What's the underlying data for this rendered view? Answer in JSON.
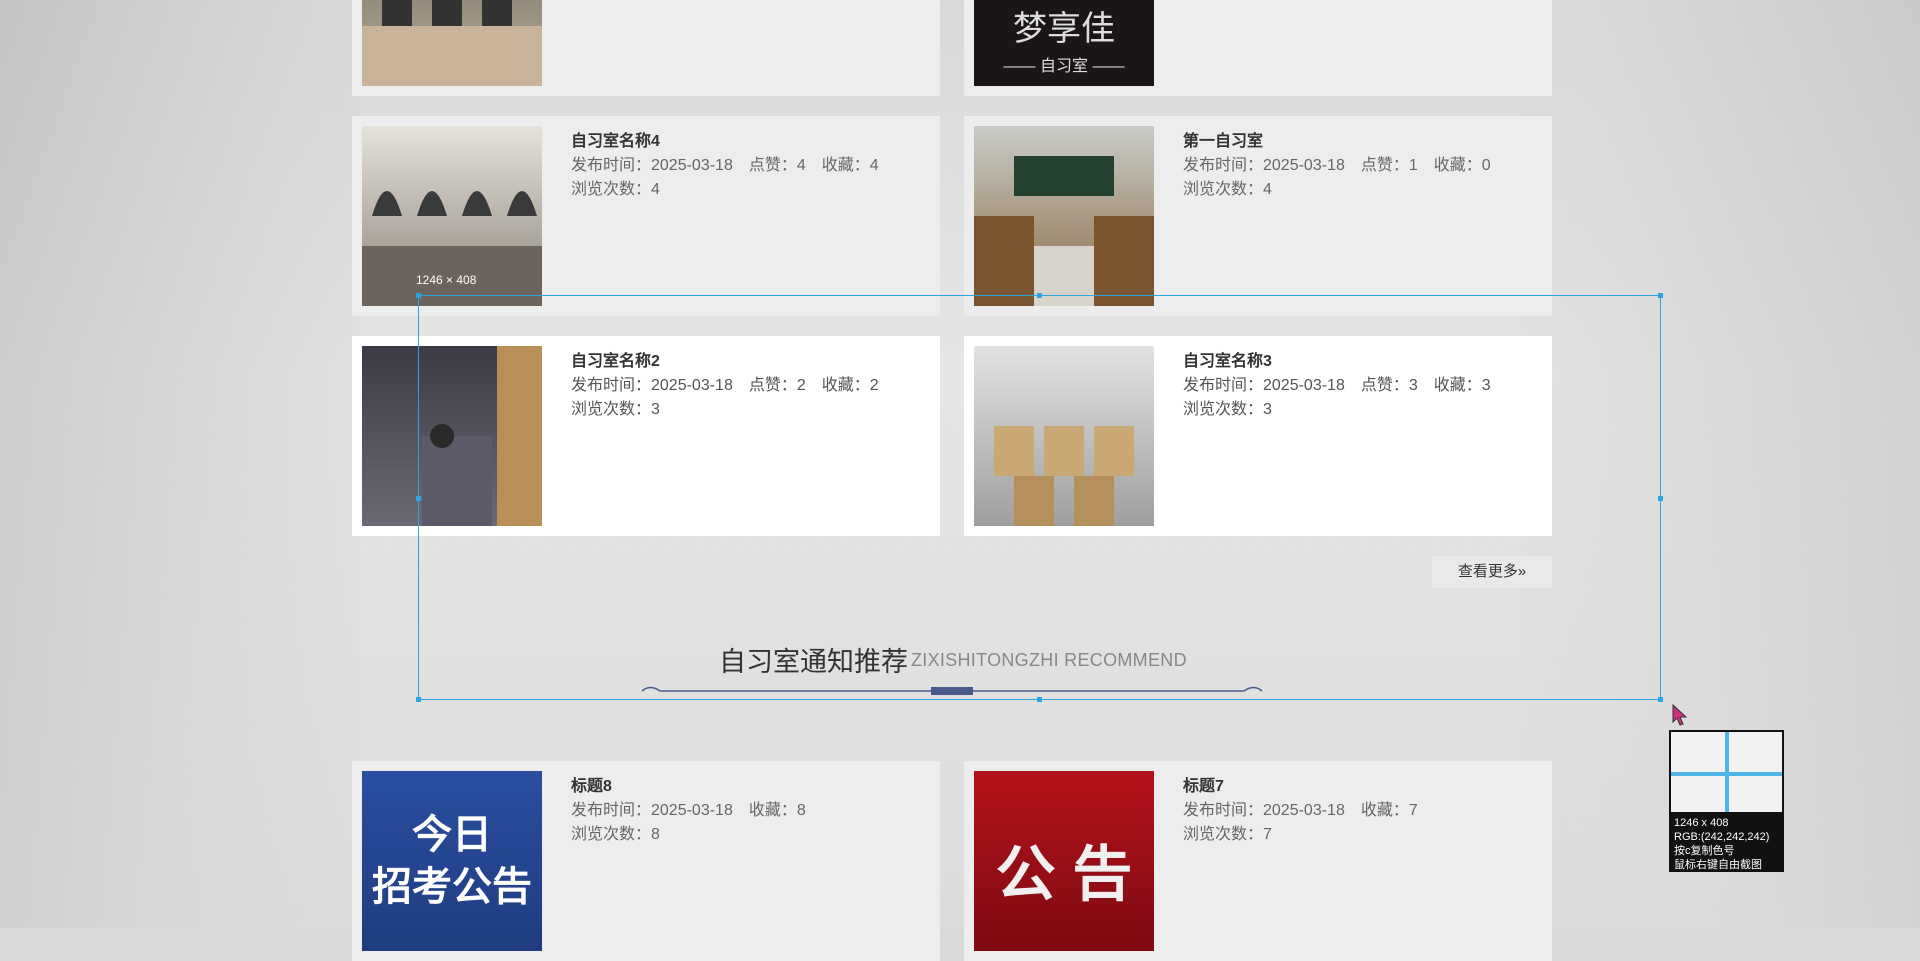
{
  "selection": {
    "size_label": "1246 × 408"
  },
  "cards": [
    {
      "title": "",
      "meta": "",
      "views": ""
    },
    {
      "title": "",
      "meta": "",
      "views": "",
      "image_text": "梦享佳",
      "image_sub": "—— 自习室 ——"
    },
    {
      "title": "自习室名称4",
      "time": "发布时间：2025-03-18",
      "likes": "点赞：4",
      "fav": "收藏：4",
      "views": "浏览次数：4"
    },
    {
      "title": "第一自习室",
      "time": "发布时间：2025-03-18",
      "likes": "点赞：1",
      "fav": "收藏：0",
      "views": "浏览次数：4"
    },
    {
      "title": "自习室名称2",
      "time": "发布时间：2025-03-18",
      "likes": "点赞：2",
      "fav": "收藏：2",
      "views": "浏览次数：3"
    },
    {
      "title": "自习室名称3",
      "time": "发布时间：2025-03-18",
      "likes": "点赞：3",
      "fav": "收藏：3",
      "views": "浏览次数：3"
    },
    {
      "title": "标题8",
      "time": "发布时间：2025-03-18",
      "fav": "收藏：8",
      "views": "浏览次数：8",
      "image_text": "今日\n招考公告"
    },
    {
      "title": "标题7",
      "time": "发布时间：2025-03-18",
      "fav": "收藏：7",
      "views": "浏览次数：7",
      "image_text": "公 告"
    }
  ],
  "more_button": "查看更多»",
  "section": {
    "title": "自习室通知推荐",
    "subtitle": "ZIXISHITONGZHI RECOMMEND"
  },
  "magnifier": {
    "size": "1246 x 408",
    "rgb": "RGB:(242,242,242)",
    "copy_hint": "按c复制色号",
    "right_click_hint": "鼠标右键自由截图"
  },
  "colors": {
    "accent": "#2aa5e0",
    "divider": "#4a5a8a",
    "notice_blue": "#2a4fa0",
    "notice_red": "#b4121a"
  }
}
